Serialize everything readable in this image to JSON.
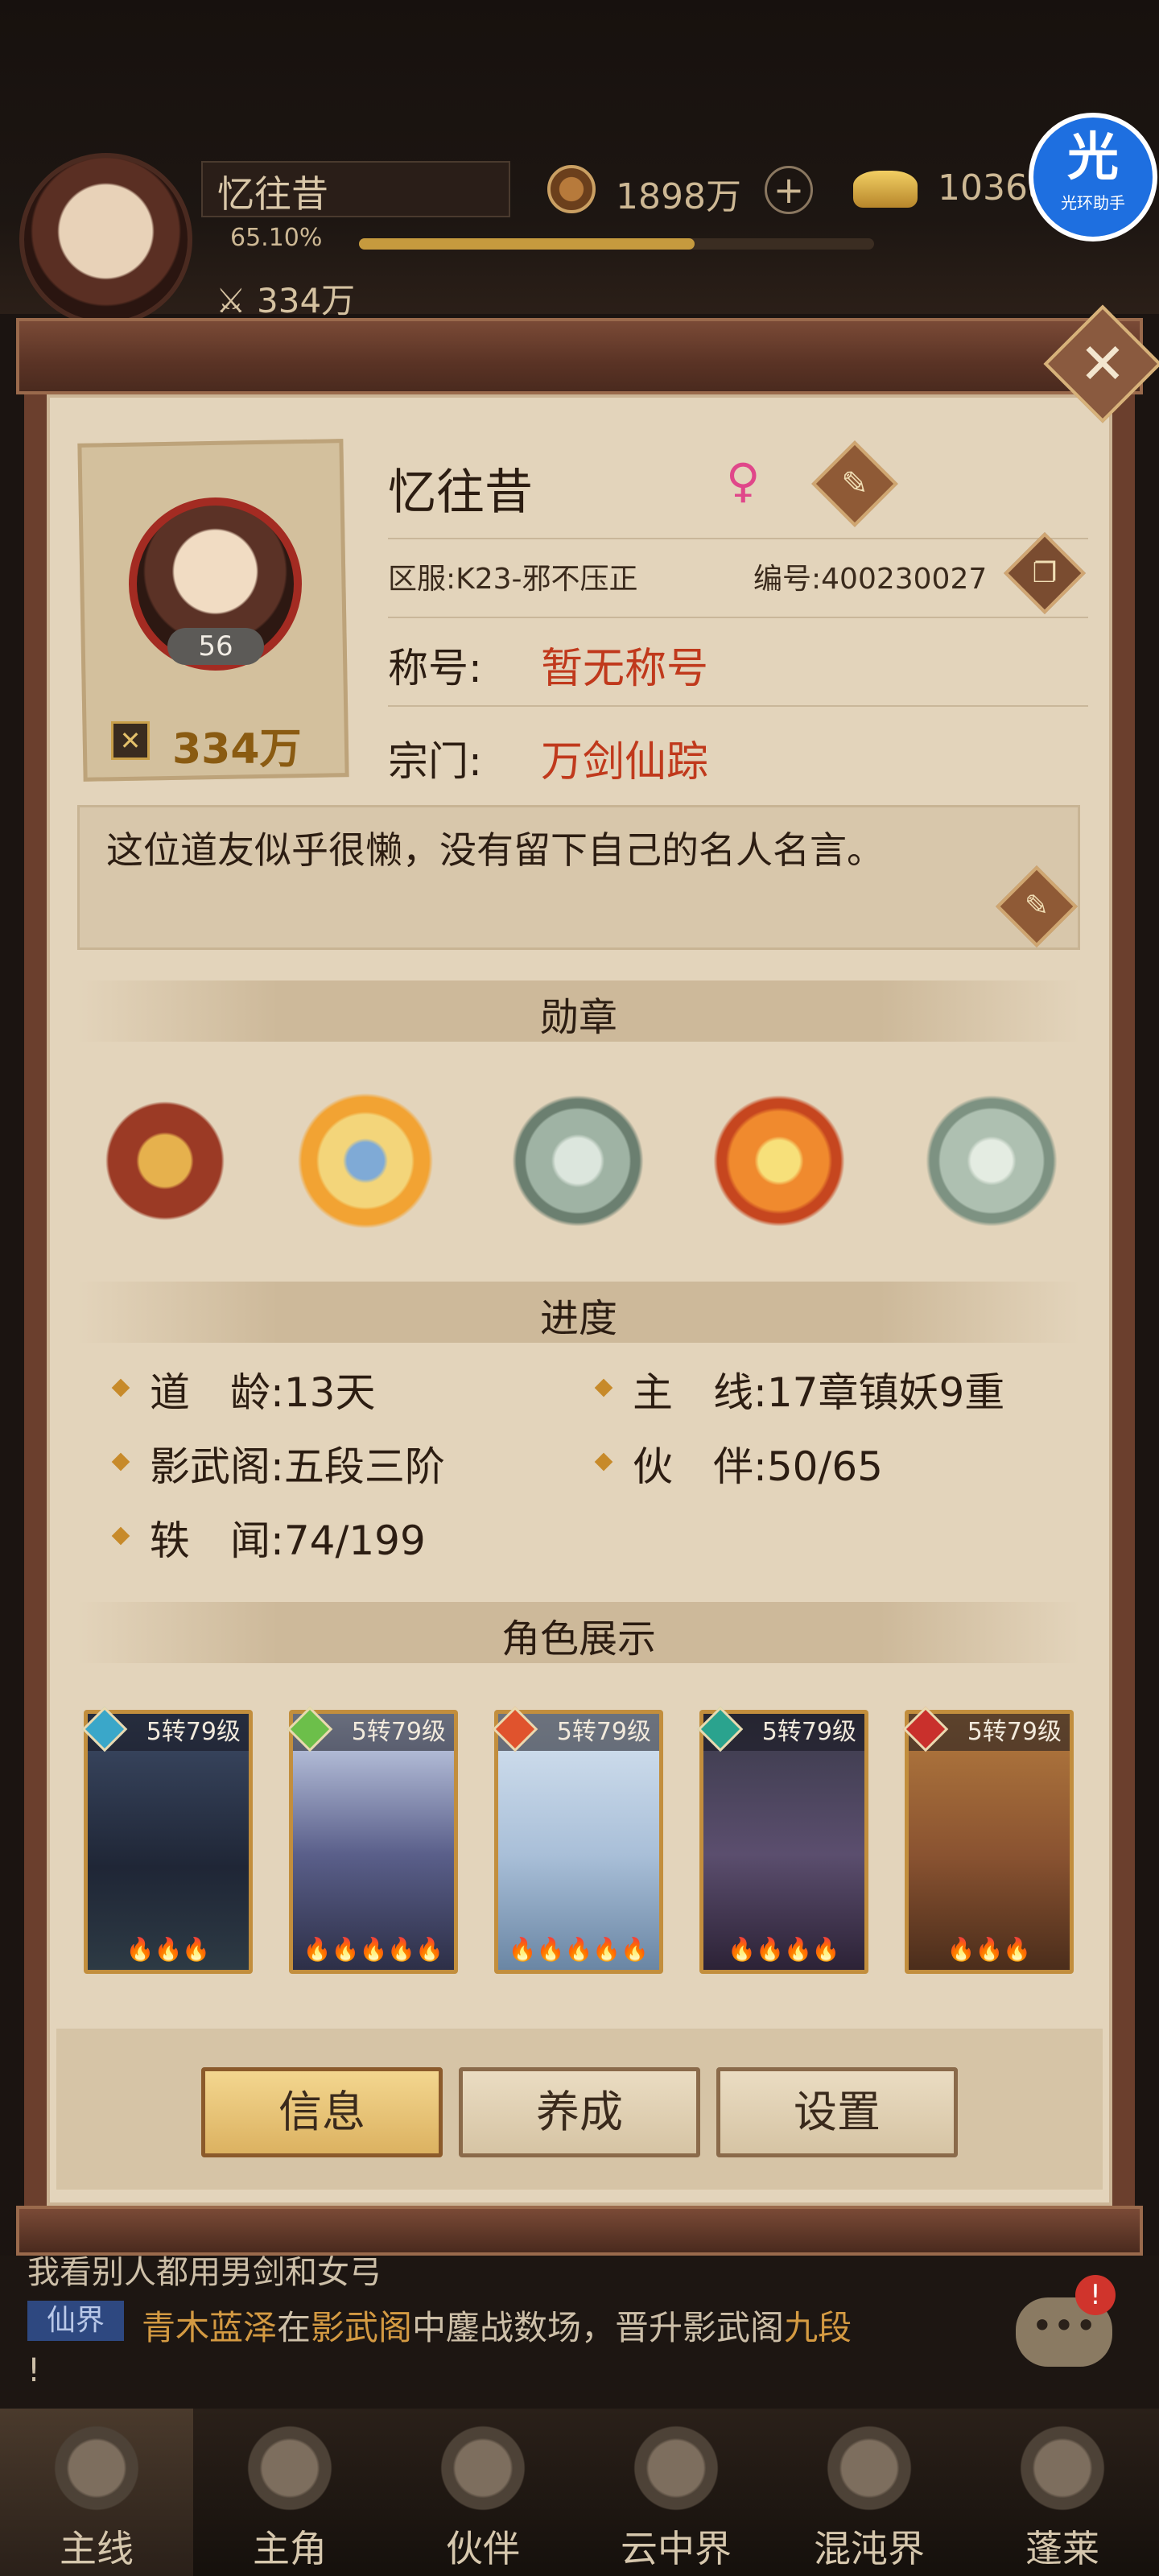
{
  "hud": {
    "player_name": "忆往昔",
    "exp_percent": "65.10%",
    "exp_fraction": 0.651,
    "power": "334万",
    "coins": "1898万",
    "gold": "10368",
    "helper_badge": "光",
    "helper_label": "光环助手"
  },
  "profile": {
    "name": "忆往昔",
    "gender_symbol": "♀",
    "level": "56",
    "power": "334万",
    "server": "区服:K23-邪不压正",
    "uid": "编号:400230027",
    "title_label": "称号:",
    "title_value": "暂无称号",
    "sect_label": "宗门:",
    "sect_value": "万剑仙踪",
    "motto": "这位道友似乎很懒，没有留下自己的名人名言。"
  },
  "sections": {
    "medals": "勋章",
    "progress": "进度",
    "roles": "角色展示"
  },
  "progress": [
    {
      "label": "道　龄:",
      "value": "13天"
    },
    {
      "label": "主　线:",
      "value": "17章镇妖9重"
    },
    {
      "label": "影武阁:",
      "value": "五段三阶"
    },
    {
      "label": "伙　伴:",
      "value": "50/65"
    },
    {
      "label": "轶　闻:",
      "value": "74/199"
    }
  ],
  "roles": [
    {
      "level": "5转79级",
      "stars": "🔥🔥🔥",
      "element_color": "#3aa7c9"
    },
    {
      "level": "5转79级",
      "stars": "🔥🔥🔥🔥🔥",
      "element_color": "#6cbf4a"
    },
    {
      "level": "5转79级",
      "stars": "🔥🔥🔥🔥🔥",
      "element_color": "#e0532d"
    },
    {
      "level": "5转79级",
      "stars": "🔥🔥🔥🔥",
      "element_color": "#2aa38e"
    },
    {
      "level": "5转79级",
      "stars": "🔥🔥🔥",
      "element_color": "#c9302c"
    }
  ],
  "buttons": {
    "info": "信息",
    "cultivate": "养成",
    "settings": "设置"
  },
  "chat": {
    "line1": "我看别人都用男剑和女弓",
    "tag": "仙界",
    "player": "青木蓝泽",
    "text_a": "在",
    "place": "影武阁",
    "text_b": "中鏖战数场，晋升影武阁",
    "rank": "九段",
    "line3": "!",
    "badge": "!"
  },
  "nav": [
    {
      "label": "主线"
    },
    {
      "label": "主角"
    },
    {
      "label": "伙伴"
    },
    {
      "label": "云中界"
    },
    {
      "label": "混沌界"
    },
    {
      "label": "蓬莱"
    }
  ],
  "colors": {
    "accent_red": "#c0391c",
    "gold_text": "#8a5b12",
    "panel_bg": "#e3d4bb"
  },
  "icons": {
    "close": "close-icon",
    "edit": "brush-icon",
    "copy": "copy-icon",
    "chat": "chat-bubble-icon"
  }
}
